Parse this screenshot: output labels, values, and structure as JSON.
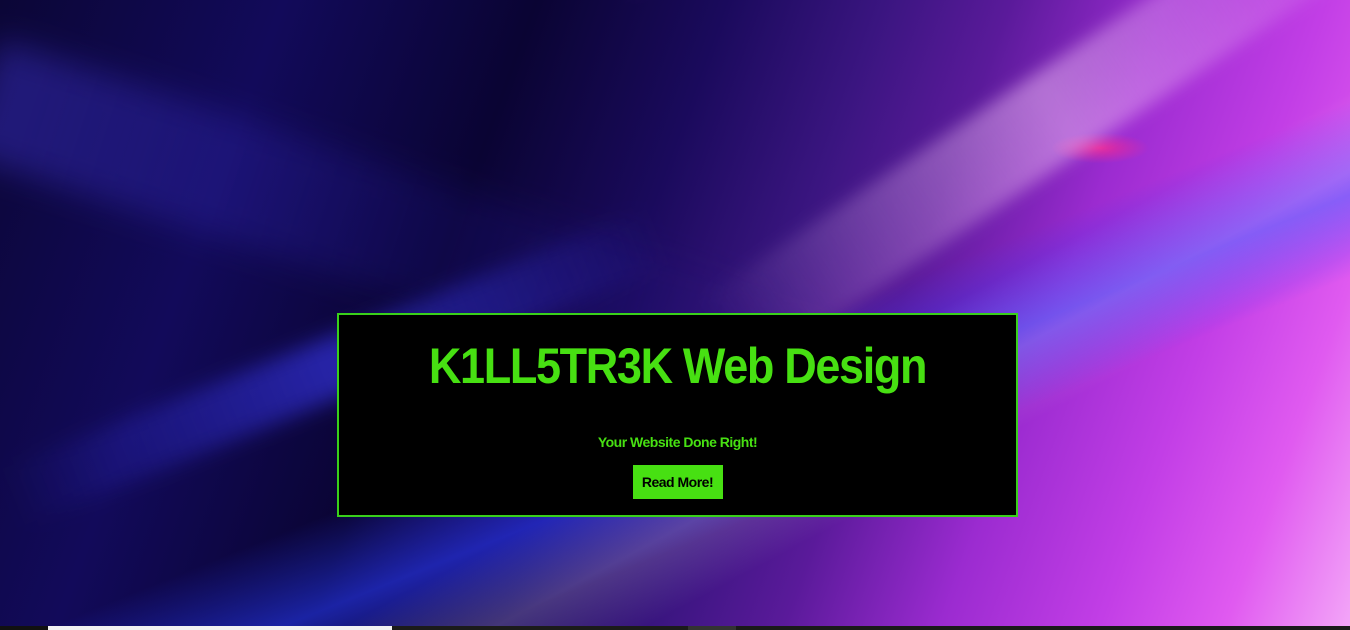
{
  "hero": {
    "title": "K1LL5TR3K Web Design",
    "tagline": "Your Website Done Right!",
    "button_label": "Read More!"
  },
  "colors": {
    "accent_green": "#47e012",
    "panel_bg": "#000000"
  }
}
